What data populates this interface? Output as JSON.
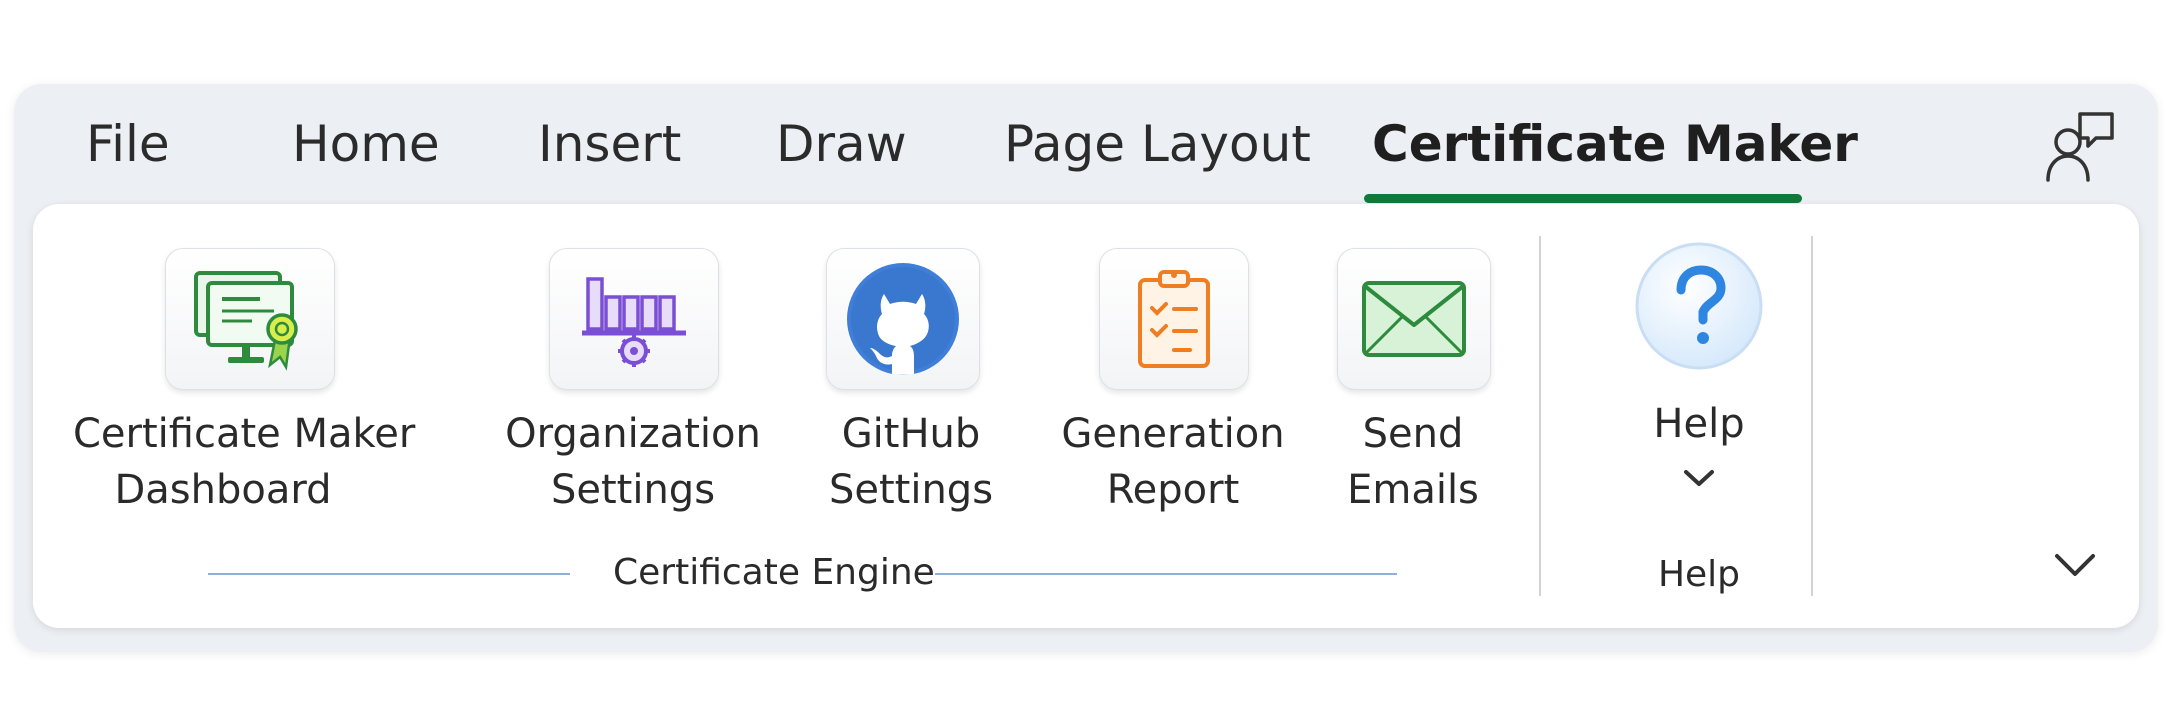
{
  "tabs": [
    "File",
    "Home",
    "Insert",
    "Draw",
    "Page Layout",
    "Certificate Maker"
  ],
  "active_tab": "Certificate Maker",
  "accent_color": "#0f7b3b",
  "share_icon": "share-person-icon",
  "ribbon": {
    "groups": {
      "engine": {
        "label": "Certificate Engine",
        "buttons": [
          {
            "line1": "Certificate Maker",
            "line2": "Dashboard",
            "icon": "certificate-dashboard-icon"
          },
          {
            "line1": "Organization",
            "line2": "Settings",
            "icon": "organization-settings-icon"
          },
          {
            "line1": "GitHub",
            "line2": "Settings",
            "icon": "github-icon"
          },
          {
            "line1": "Generation",
            "line2": "Report",
            "icon": "clipboard-report-icon"
          },
          {
            "line1": "Send",
            "line2": "Emails",
            "icon": "envelope-icon"
          }
        ]
      },
      "help": {
        "label": "Help",
        "button_label": "Help",
        "icon": "help-question-icon"
      }
    },
    "collapse_icon": "chevron-down-icon"
  }
}
